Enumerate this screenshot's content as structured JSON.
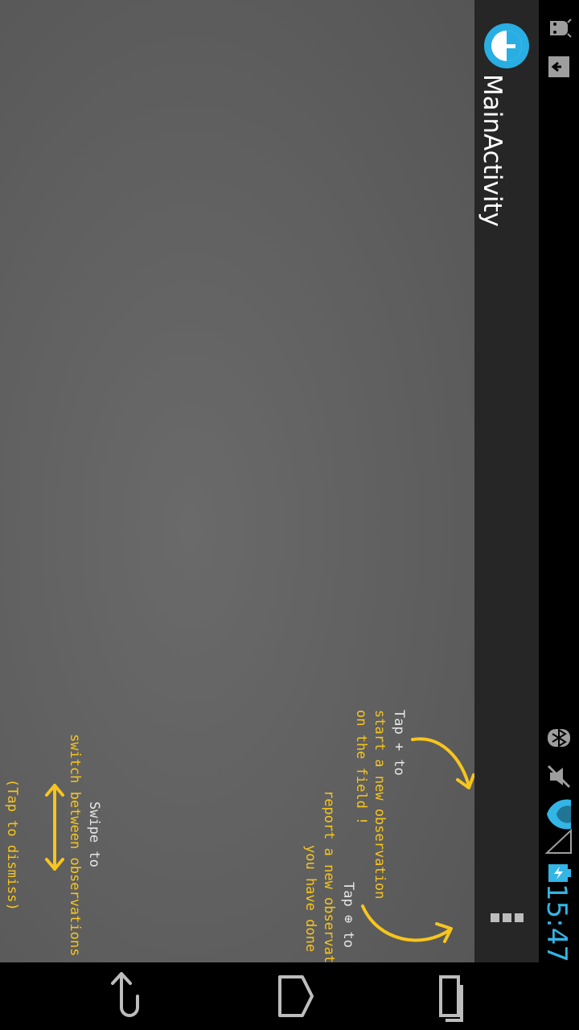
{
  "status_bar": {
    "time": "15:47",
    "icons": [
      "android-icon",
      "download-icon",
      "bluetooth-icon",
      "mute-icon",
      "wifi-icon",
      "signal-icon",
      "battery-icon"
    ]
  },
  "action_bar": {
    "title": "MainActivity",
    "app_icon": "app-logo-icon",
    "overflow_icon": "overflow-menu-icon"
  },
  "tutorial": {
    "new_observation_title": "Tap + to",
    "new_observation_line2": "start a new observation",
    "new_observation_line3": "on the field !",
    "report_title": "Tap ⊕ to",
    "report_line2": "report a new observation",
    "report_line3": "you have done !",
    "swipe_title": "Swipe to",
    "swipe_line2": "switch between observations !",
    "dismiss": "(Tap to dismiss)"
  },
  "nav_bar": {
    "icons": [
      "back-icon",
      "home-icon",
      "recent-apps-icon"
    ]
  },
  "colors": {
    "accent": "#f7c51e",
    "clock": "#33b5e5",
    "action_bar": "#262626",
    "content_bg": "#606060"
  }
}
